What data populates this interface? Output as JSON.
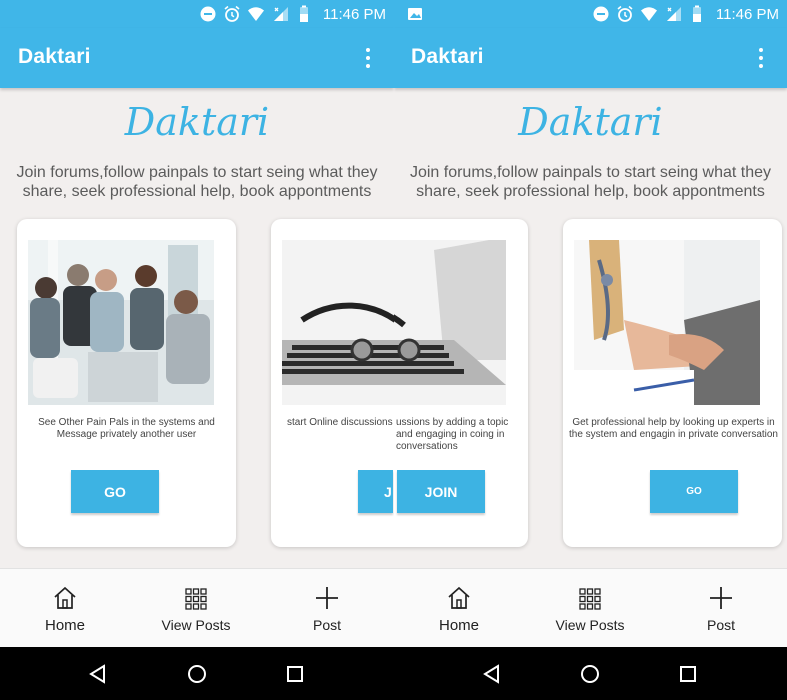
{
  "status": {
    "time": "11:46 PM",
    "icons": [
      "do-not-disturb-icon",
      "alarm-icon",
      "wifi-icon",
      "signal-icon",
      "battery-icon"
    ]
  },
  "app": {
    "title": "Daktari",
    "accent": "#40b6e8",
    "menu_icon": "more-vert-icon"
  },
  "hero": {
    "title": "Daktari",
    "subtitle": "Join forums,follow painpals to start seing what they share, seek professional help, book appontments"
  },
  "left_screen": {
    "cards": [
      {
        "text": "See Other Pain Pals in the systems and Message privately another user",
        "button": "GO"
      },
      {
        "text": "start Online discussions",
        "button": "J"
      }
    ]
  },
  "right_screen": {
    "status_extra_icon": "image-icon",
    "cards": [
      {
        "text": "ussions by adding a topic and engaging in coing in conversations",
        "text_lead": "engaging in co",
        "button": "JOIN"
      },
      {
        "text": "Get professional help by looking up experts in the system and engagin in private conversation",
        "button": "GO"
      }
    ]
  },
  "bottom_nav": {
    "items": [
      {
        "label": "Home",
        "icon": "home-icon"
      },
      {
        "label": "View Posts",
        "icon": "grid-icon"
      },
      {
        "label": "Post",
        "icon": "plus-icon"
      }
    ]
  },
  "system_nav": [
    "back-icon",
    "home-circle-icon",
    "recents-icon"
  ]
}
